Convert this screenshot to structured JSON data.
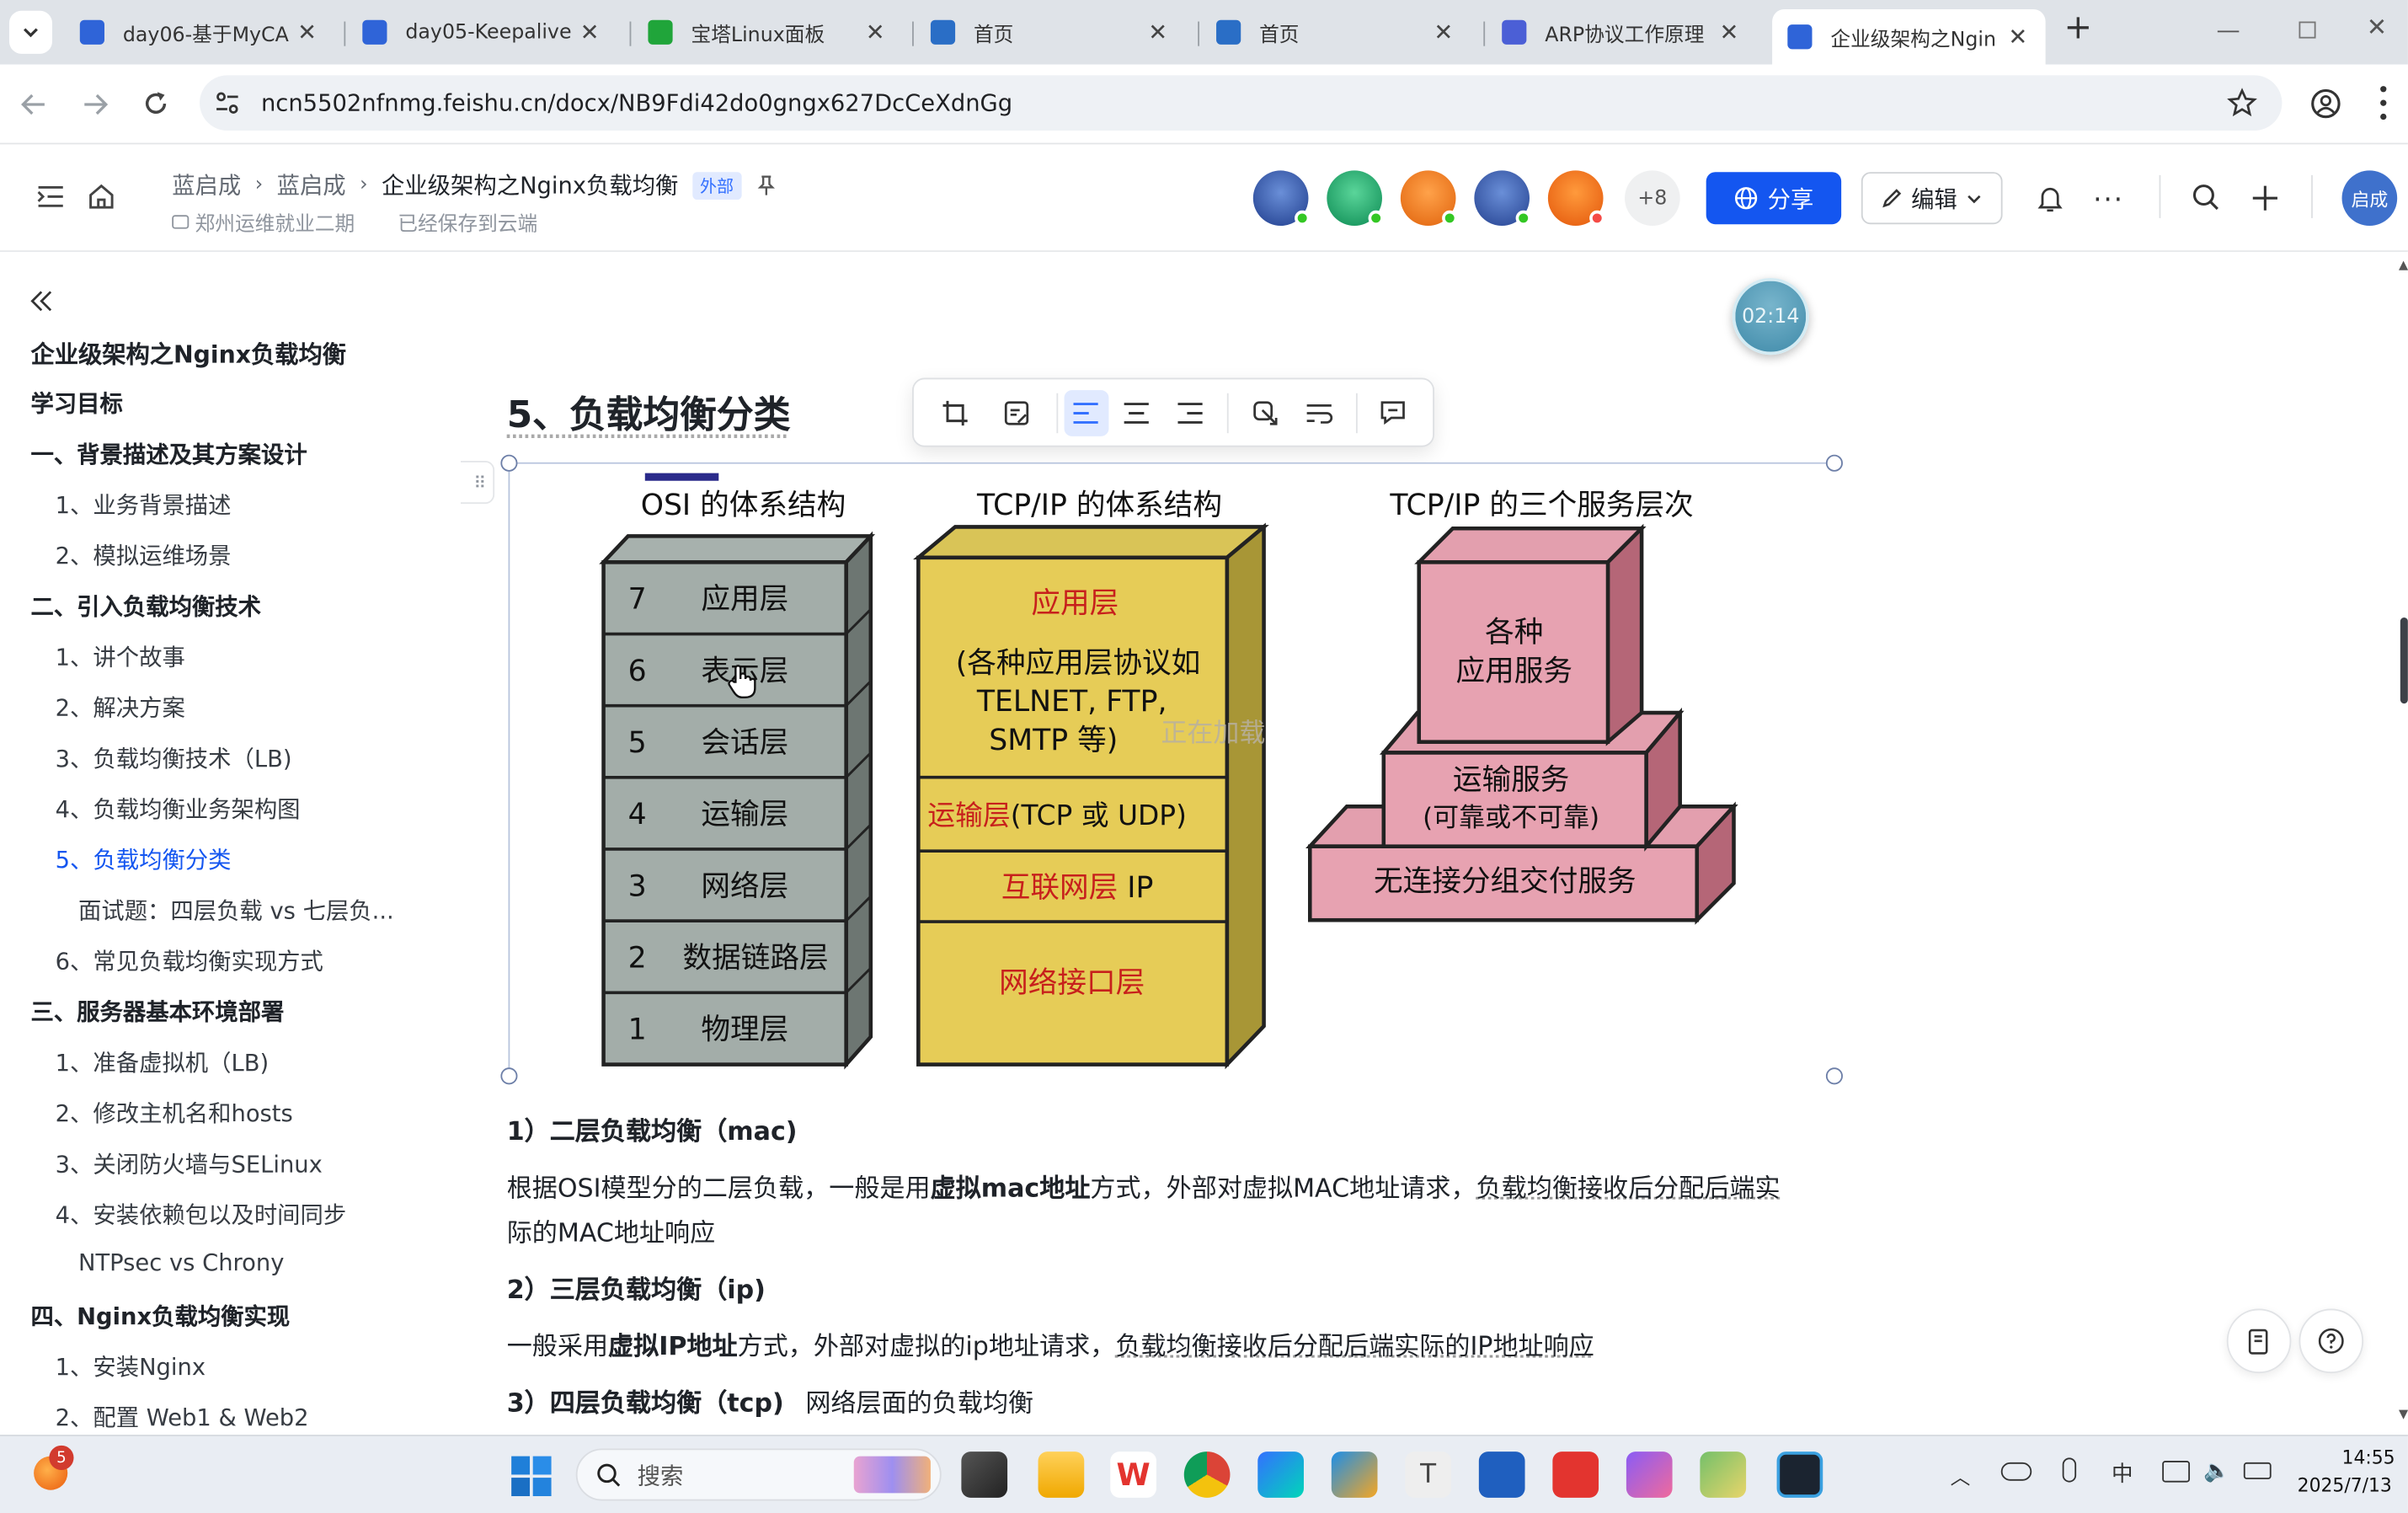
{
  "browser": {
    "tabs": [
      {
        "title": "day06-基于MyCA",
        "active": false,
        "color": "#2f64d8"
      },
      {
        "title": "day05-Keepalive",
        "active": false,
        "color": "#2f64d8"
      },
      {
        "title": "宝塔Linux面板",
        "active": false,
        "color": "#20a53a"
      },
      {
        "title": "首页",
        "active": false,
        "color": "#2a6ec6"
      },
      {
        "title": "首页",
        "active": false,
        "color": "#2a6ec6"
      },
      {
        "title": "ARP协议工作原理",
        "active": false,
        "color": "#4b5fd6"
      },
      {
        "title": "企业级架构之Ngin",
        "active": true,
        "color": "#2f64d8"
      }
    ],
    "new_tab": "+",
    "url": "ncn5502nfnmg.feishu.cn/docx/NB9Fdi42do0gngx627DcCeXdnGg"
  },
  "header": {
    "breadcrumb": [
      "蓝启成",
      "蓝启成",
      "企业级架构之Nginx负载均衡"
    ],
    "external_tag": "外部",
    "workspace": "郑州运维就业二期",
    "save_status": "已经保存到云端",
    "more_count": "+8",
    "share_label": "分享",
    "edit_label": "编辑",
    "user_avatar": "启成"
  },
  "timer": "02:14",
  "sidebar": {
    "title": "企业级架构之Nginx负载均衡",
    "items": [
      {
        "label": "学习目标",
        "level": 0
      },
      {
        "label": "一、背景描述及其方案设计",
        "level": 0
      },
      {
        "label": "1、业务背景描述",
        "level": 1
      },
      {
        "label": "2、模拟运维场景",
        "level": 1
      },
      {
        "label": "二、引入负载均衡技术",
        "level": 0
      },
      {
        "label": "1、讲个故事",
        "level": 1
      },
      {
        "label": "2、解决方案",
        "level": 1
      },
      {
        "label": "3、负载均衡技术（LB)",
        "level": 1
      },
      {
        "label": "4、负载均衡业务架构图",
        "level": 1
      },
      {
        "label": "5、负载均衡分类",
        "level": 1,
        "active": true
      },
      {
        "label": "面试题：四层负载 vs 七层负...",
        "level": 2
      },
      {
        "label": "6、常见负载均衡实现方式",
        "level": 1
      },
      {
        "label": "三、服务器基本环境部署",
        "level": 0
      },
      {
        "label": "1、准备虚拟机（LB)",
        "level": 1
      },
      {
        "label": "2、修改主机名和hosts",
        "level": 1
      },
      {
        "label": "3、关闭防火墙与SELinux",
        "level": 1
      },
      {
        "label": "4、安装依赖包以及时间同步",
        "level": 1
      },
      {
        "label": "NTPsec vs Chrony",
        "level": 2
      },
      {
        "label": "四、Nginx负载均衡实现",
        "level": 0
      },
      {
        "label": "1、安装Nginx",
        "level": 1
      },
      {
        "label": "2、配置 Web1 & Web2",
        "level": 1
      }
    ]
  },
  "doc": {
    "heading": "5、负载均衡分类",
    "figure": {
      "osi_title": "OSI 的体系结构",
      "osi_layers": [
        {
          "num": "7",
          "name": "应用层"
        },
        {
          "num": "6",
          "name": "表示层"
        },
        {
          "num": "5",
          "name": "会话层"
        },
        {
          "num": "4",
          "name": "运输层"
        },
        {
          "num": "3",
          "name": "网络层"
        },
        {
          "num": "2",
          "name": "数据链路层"
        },
        {
          "num": "1",
          "name": "物理层"
        }
      ],
      "tcp_title": "TCP/IP 的体系结构",
      "tcp_app": "应用层",
      "tcp_app_desc": [
        "(各种应用层协议如",
        "TELNET, FTP,",
        "SMTP 等)"
      ],
      "tcp_transport_red": "运输层",
      "tcp_transport_black": "(TCP 或 UDP)",
      "tcp_internet_red": "互联网层",
      "tcp_internet_black": " IP",
      "tcp_netif": "网络接口层",
      "loading_text": "正在加载",
      "svc_title": "TCP/IP 的三个服务层次",
      "svc_top": [
        "各种",
        "应用服务"
      ],
      "svc_mid": [
        "运输服务",
        "(可靠或不可靠)"
      ],
      "svc_bottom": "无连接分组交付服务"
    },
    "s1_title": "1）二层负载均衡（mac)",
    "s1_line1_a": "根据OSI模型分的二层负载，一般是用",
    "s1_line1_b": "虚拟mac地址",
    "s1_line1_c": "方式，外部对虚拟MAC地址请求，",
    "s1_line1_d": "负载均衡接收后分配后端实",
    "s1_line2": "际的MAC地址响应",
    "s2_title": "2）三层负载均衡（ip)",
    "s2_a": "一般采用",
    "s2_b": "虚拟IP地址",
    "s2_c": "方式，外部对虚拟的ip地址请求，",
    "s2_d": "负载均衡接收后分配后端实际的IP地址响应",
    "s3_title": "3）四层负载均衡（tcp)",
    "s3_tail": "网络层面的负载均衡"
  },
  "taskbar": {
    "badge": "5",
    "search_placeholder": "搜索",
    "time": "14:55",
    "date": "2025/7/13",
    "ime": "中"
  }
}
